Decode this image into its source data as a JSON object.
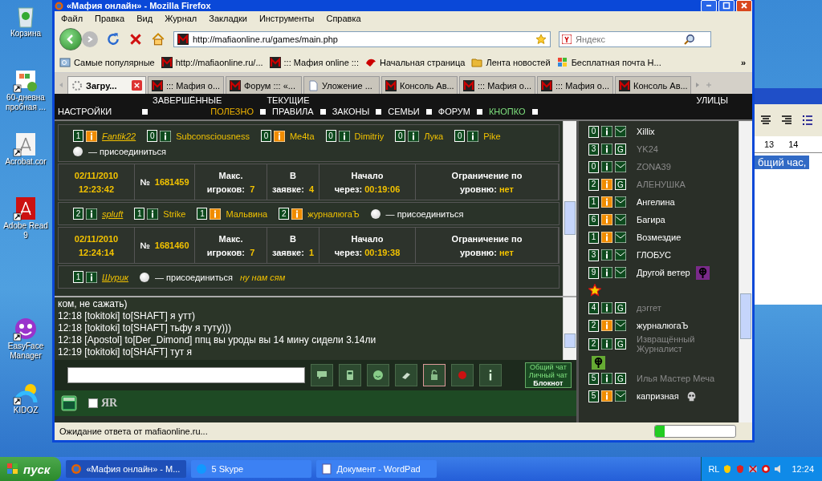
{
  "desktop_icons": [
    {
      "kind": "recycle",
      "lines": [
        "Корзина"
      ]
    },
    {
      "kind": "office",
      "lines": [
        "60-дневна",
        "пробная ..."
      ]
    },
    {
      "kind": "acrobat",
      "lines": [
        "Acrobat.cor"
      ]
    },
    {
      "kind": "reader",
      "lines": [
        "Adobe Read",
        "9"
      ]
    },
    {
      "kind": "easyface",
      "lines": [
        "EasyFace",
        "Manager"
      ]
    },
    {
      "kind": "kidoz",
      "lines": [
        "KIDOZ"
      ]
    }
  ],
  "wordpad": {
    "ruler": [
      "13",
      "14"
    ],
    "selected_text": "бщий час,"
  },
  "window": {
    "title": "«Мафия онлайн» - Mozilla Firefox",
    "menu": [
      "Файл",
      "Правка",
      "Вид",
      "Журнал",
      "Закладки",
      "Инструменты",
      "Справка"
    ],
    "url": "http://mafiaonline.ru/games/main.php",
    "search_placeholder": "Яндекс",
    "bookmarks": [
      {
        "kind": "search",
        "label": "Самые популярные"
      },
      {
        "kind": "mafia",
        "label": "http://mafiaonline.ru/..."
      },
      {
        "kind": "mafia",
        "label": "::: Мафия online :::"
      },
      {
        "kind": "animal",
        "label": "Начальная страница"
      },
      {
        "kind": "rss",
        "label": "Лента новостей"
      },
      {
        "kind": "flag",
        "label": "Бесплатная почта Н..."
      }
    ],
    "bookmarks_more": "»",
    "tabs": [
      {
        "kind": "spinner",
        "label": "Загру...",
        "selected": true
      },
      {
        "kind": "mafia",
        "label": "::: Мафия о...",
        "selected": false
      },
      {
        "kind": "mafia",
        "label": "Форум ::: «...",
        "selected": false
      },
      {
        "kind": "page",
        "label": "Уложение ...",
        "selected": false
      },
      {
        "kind": "mafia",
        "label": "Консоль Ав...",
        "selected": false
      },
      {
        "kind": "mafia",
        "label": "::: Мафия о...",
        "selected": false
      },
      {
        "kind": "mafia",
        "label": "::: Мафия о...",
        "selected": false
      },
      {
        "kind": "mafia",
        "label": "Консоль Ав...",
        "selected": false
      }
    ],
    "status": "Ожидание ответа от mafiaonline.ru...",
    "progress": {
      "level": 0.12
    }
  },
  "game_nav": {
    "top": [
      {
        "label": "ЗАВЕРШЁННЫЕ"
      },
      {
        "label": "ТЕКУЩИЕ"
      }
    ],
    "items": [
      {
        "label": "НАСТРОЙКИ",
        "color": "#ffffff"
      },
      {
        "label": "ПОЛЕЗНО",
        "color": "#f0b400"
      },
      {
        "label": "ПРАВИЛА",
        "color": "#ffffff"
      },
      {
        "label": "ЗАКОНЫ",
        "color": "#ffffff"
      },
      {
        "label": "СЕМЬИ",
        "color": "#ffffff"
      },
      {
        "label": "ФОРУМ",
        "color": "#ffffff"
      },
      {
        "label": "КНОПКО",
        "color": "#7ee07e"
      }
    ],
    "right": "УЛИЦЫ"
  },
  "games": [
    {
      "players": [
        {
          "level": "1",
          "highlighted": true,
          "name": "Fantik22",
          "creator": true
        },
        {
          "level": "0",
          "highlighted": false,
          "name": "Subconsciousness",
          "creator": false
        },
        {
          "level": "0",
          "highlighted": true,
          "name": "Me4ta",
          "creator": false
        },
        {
          "level": "0",
          "highlighted": false,
          "name": "Dimitriy",
          "creator": false
        },
        {
          "level": "0",
          "highlighted": false,
          "name": "Лука",
          "creator": false
        },
        {
          "level": "0",
          "highlighted": false,
          "name": "Pike",
          "creator": false
        }
      ],
      "join": "— присоединиться",
      "join_selected": false
    },
    {
      "header": {
        "date": "02/11/2010",
        "time": "12:23:42",
        "number_sign": "№",
        "number": "1681459",
        "max_title": "Макс.",
        "max_label": "игроков:",
        "max": "7",
        "req_title": "В",
        "req_label": "заявке:",
        "req": "4",
        "start_title": "Начало",
        "start_label": "через:",
        "start": "00:19:06",
        "limit_title": "Ограничение по",
        "limit_label": "уровню:",
        "limit": "нет"
      },
      "players": [
        {
          "level": "2",
          "highlighted": false,
          "name": "spluft",
          "creator": true
        },
        {
          "level": "1",
          "highlighted": false,
          "name": "Strike",
          "creator": false
        },
        {
          "level": "1",
          "highlighted": true,
          "name": "Мальвина",
          "creator": false
        },
        {
          "level": "2",
          "highlighted": true,
          "name": "журналюгаЪ",
          "creator": false
        }
      ],
      "join": "— присоединиться",
      "join_selected": false
    },
    {
      "header": {
        "date": "02/11/2010",
        "time": "12:24:14",
        "number_sign": "№",
        "number": "1681460",
        "max_title": "Макс.",
        "max_label": "игроков:",
        "max": "7",
        "req_title": "В",
        "req_label": "заявке:",
        "req": "1",
        "start_title": "Начало",
        "start_label": "через:",
        "start": "00:19:38",
        "limit_title": "Ограничение по",
        "limit_label": "уровню:",
        "limit": "нет"
      },
      "players": [
        {
          "level": "1",
          "highlighted": false,
          "name": "Шурик",
          "creator": true
        }
      ],
      "join": "— присоединиться",
      "join_selected": false,
      "comment": "ну нам сям"
    }
  ],
  "chat": {
    "lines": [
      "ком, не сажать)",
      "12:18 [tokitoki] to[SHAFT] я утт)",
      "12:18 [tokitoki] to[SHAFT] тьфу я туту)))",
      "12:18 [Apostol] to[Der_Dimond] ппц вы уроды вы 14 мину сидели 3.14ли",
      "12:19 [tokitoki] to[SHAFT] тут я"
    ],
    "modes": [
      {
        "label": "Общий чат",
        "selected": false
      },
      {
        "label": "Личный чат",
        "selected": false
      },
      {
        "label": "Блокнот",
        "selected": true
      }
    ],
    "logo": "ЯR",
    "checkbox": {
      "checked": false
    }
  },
  "sidebar": {
    "players": [
      {
        "level": "0",
        "highlighted": false,
        "badge": {
          "kind": "mail"
        },
        "name": "Xillix",
        "dimmed": false
      },
      {
        "level": "3",
        "highlighted": false,
        "badge": {
          "kind": "letter",
          "text": "G"
        },
        "name": "YK24",
        "dimmed": true
      },
      {
        "level": "0",
        "highlighted": false,
        "badge": {
          "kind": "mail"
        },
        "name": "ZONA39",
        "dimmed": true
      },
      {
        "level": "2",
        "highlighted": true,
        "badge": {
          "kind": "letter",
          "text": "G"
        },
        "name": "АЛЕНУШКА",
        "dimmed": true
      },
      {
        "level": "1",
        "highlighted": true,
        "badge": {
          "kind": "mail"
        },
        "name": "Ангелина",
        "dimmed": false
      },
      {
        "level": "6",
        "highlighted": true,
        "badge": {
          "kind": "mail"
        },
        "name": "Багира",
        "dimmed": false
      },
      {
        "level": "1",
        "highlighted": true,
        "badge": {
          "kind": "mail"
        },
        "name": "Возмездие",
        "dimmed": false
      },
      {
        "level": "3",
        "highlighted": false,
        "badge": {
          "kind": "mail"
        },
        "name": "ГЛОБУС",
        "dimmed": false
      },
      {
        "level": "9",
        "highlighted": false,
        "badge": {
          "kind": "mail"
        },
        "name": "Другой ветер",
        "dimmed": false,
        "emblem": {
          "kind": "cross",
          "color": "#7a2a8a"
        },
        "star": true
      },
      {
        "level": "4",
        "highlighted": false,
        "badge": {
          "kind": "letter",
          "text": "G"
        },
        "name": "дэггет",
        "dimmed": true
      },
      {
        "level": "2",
        "highlighted": true,
        "badge": {
          "kind": "mail"
        },
        "name": "журналюгаЪ",
        "dimmed": false
      },
      {
        "level": "2",
        "highlighted": false,
        "badge": {
          "kind": "letter",
          "text": "G"
        },
        "name": "Извращённый Журналист",
        "dimmed": true,
        "emblem": {
          "kind": "cross",
          "color": "#66aa33"
        }
      },
      {
        "level": "5",
        "highlighted": false,
        "badge": {
          "kind": "letter",
          "text": "G"
        },
        "name": "Илья Мастер Меча",
        "dimmed": true
      },
      {
        "level": "5",
        "highlighted": true,
        "badge": {
          "kind": "mail"
        },
        "name": "капризная",
        "dimmed": false,
        "emblem": {
          "kind": "skull"
        }
      }
    ]
  },
  "taskbar": {
    "start": "пуск",
    "tasks": [
      {
        "kind": "firefox",
        "label": "«Мафия онлайн» - M...",
        "selected": true
      },
      {
        "kind": "skype",
        "label": "5 Skype",
        "selected": false
      },
      {
        "kind": "wordpad",
        "label": "Документ - WordPad",
        "selected": false
      }
    ],
    "tray_label": "RL",
    "clock": "12:24"
  }
}
